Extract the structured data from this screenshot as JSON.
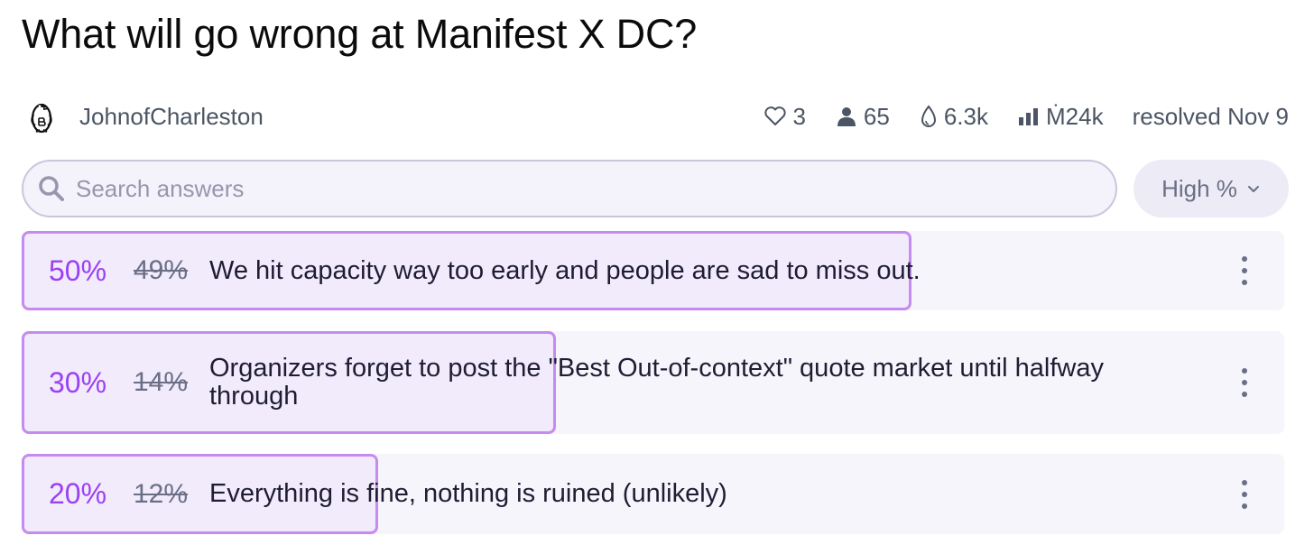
{
  "market": {
    "title": "What will go wrong at Manifest X DC?",
    "creator": "JohnofCharleston",
    "stats": {
      "likes": "3",
      "traders": "65",
      "volume": "6.3k",
      "liquidity": "Ṁ24k",
      "status": "resolved Nov 9"
    }
  },
  "search": {
    "placeholder": "Search answers"
  },
  "sort": {
    "label": "High %"
  },
  "answers": [
    {
      "prob": "50%",
      "prev_prob": "49%",
      "prob_value": 0.5,
      "text": "We hit capacity way too early and people are sad to miss out."
    },
    {
      "prob": "30%",
      "prev_prob": "14%",
      "prob_value": 0.3,
      "text": "Organizers forget to post the \"Best Out-of-context\" quote market until halfway through"
    },
    {
      "prob": "20%",
      "prev_prob": "12%",
      "prob_value": 0.2,
      "text": "Everything is fine, nothing is ruined (unlikely)"
    }
  ],
  "colors": {
    "accent": "#9b40f3",
    "bar_border": "#c58bf0",
    "row_bg": "#f6f5fb",
    "muted_text": "#6b6f86"
  },
  "icons": {
    "avatar": "penguin-avatar-icon",
    "likes": "heart-icon",
    "traders": "user-icon",
    "volume": "droplet-icon",
    "liquidity": "bar-chart-icon",
    "search": "search-icon",
    "sort": "chevron-down-icon",
    "menu": "more-vertical-icon"
  }
}
